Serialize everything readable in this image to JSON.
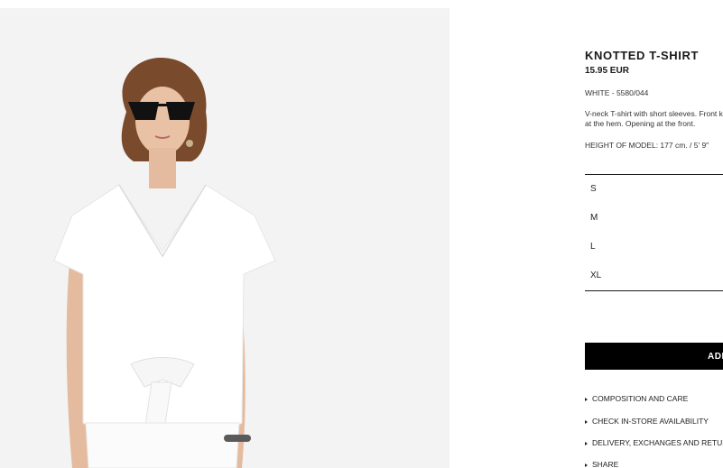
{
  "product": {
    "title": "KNOTTED T-SHIRT",
    "price": "15.95 EUR",
    "color_ref": "WHITE - 5580/044",
    "description": "V-neck T-shirt with short sleeves. Front knot detail at the hem. Opening at the front.",
    "model_height": "HEIGHT OF MODEL: 177 cm. / 5′ 9″"
  },
  "sizes": [
    "S",
    "M",
    "L",
    "XL"
  ],
  "add_button_label": "ADD",
  "links": [
    "COMPOSITION AND CARE",
    "CHECK IN-STORE AVAILABILITY",
    "DELIVERY, EXCHANGES AND RETURNS",
    "SHARE"
  ],
  "colors": {
    "button_bg": "#000000",
    "photo_bg": "#f4f4f4"
  }
}
